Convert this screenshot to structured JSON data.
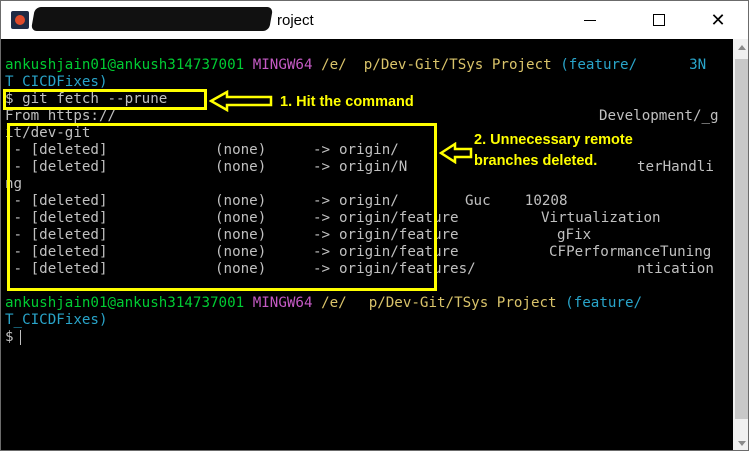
{
  "window": {
    "title": "roject",
    "minimize_icon": "minimize-icon",
    "maximize_icon": "maximize-icon",
    "close_icon": "close-icon",
    "close_glyph": "✕"
  },
  "terminal": {
    "prompt1": {
      "user": "ankushjain01@ankush314737001",
      "env": "MINGW64",
      "path": "/e/  p/Dev-Git/TSys Project",
      "branch": "(feature/",
      "branch_tail": "3N",
      "branch_line2": "T_CICDFixes)"
    },
    "command_line": "$ git fetch --prune",
    "from_line": "From https://",
    "from_right": "Development/_g",
    "git_line": "it/dev-git",
    "rows": [
      {
        "status": " - [deleted]",
        "old": "(none)",
        "arrow": "->",
        "ref": "origin/"
      },
      {
        "status": " - [deleted]",
        "old": "(none)",
        "arrow": "->",
        "ref": "origin/N",
        "ref_tail": "terHandli"
      },
      {
        "status": "ng",
        "old": "",
        "arrow": "",
        "ref": ""
      },
      {
        "status": " - [deleted]",
        "old": "(none)",
        "arrow": "->",
        "ref": "origin/",
        "ref_tail": "Guc    10208"
      },
      {
        "status": " - [deleted]",
        "old": "(none)",
        "arrow": "->",
        "ref": "origin/feature",
        "ref_tail": "Virtualization"
      },
      {
        "status": " - [deleted]",
        "old": "(none)",
        "arrow": "->",
        "ref": "origin/feature",
        "ref_tail": "gFix"
      },
      {
        "status": " - [deleted]",
        "old": "(none)",
        "arrow": "->",
        "ref": "origin/feature",
        "ref_tail": "CFPerformanceTuning"
      },
      {
        "status": " - [deleted]",
        "old": "(none)",
        "arrow": "->",
        "ref": "origin/features/",
        "ref_tail": "ntication"
      }
    ],
    "prompt2": {
      "user": "ankushjain01@ankush314737001",
      "env": "MINGW64",
      "path": "/e/",
      "path2": "p/Dev-Git/TSys Project",
      "branch": "(feature/",
      "branch_line2": "T_CICDFixes)"
    },
    "prompt_symbol": "$"
  },
  "annotations": {
    "step1": "1. Hit the command",
    "step2_line1": "2. Unnecessary remote",
    "step2_line2": "branches deleted.",
    "color": "#ffff00"
  },
  "colors": {
    "terminal_bg": "#000000",
    "text": "#c0c0c0",
    "user": "#00cc33",
    "env": "#c45ac4",
    "path": "#d9c36a",
    "branch": "#29a4c9"
  }
}
